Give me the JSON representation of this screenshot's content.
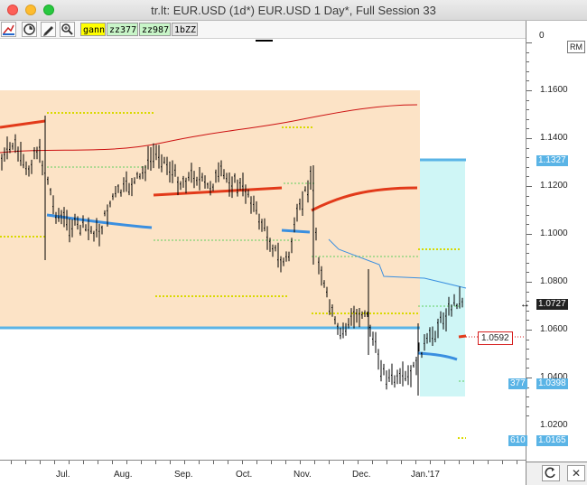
{
  "window": {
    "title": "tr.lt: EUR.USD (1d*) EUR.USD 1 Day*, Full Session 33"
  },
  "toolbar": {
    "buttons": [
      "chart-type-icon",
      "timer-icon",
      "pencil-icon",
      "zoom-icon"
    ],
    "chips": [
      {
        "label": "gann",
        "color": "#ffff00"
      },
      {
        "label": "zz377",
        "color": "#c8f5c8"
      },
      {
        "label": "zz987",
        "color": "#c8f5c8"
      },
      {
        "label": "1bZZ",
        "color": "#e6e6e6"
      }
    ]
  },
  "axis": {
    "top_label": "0",
    "rm_label": "RM",
    "price_labels": [
      "1.1600",
      "1.1400",
      "1.1200",
      "1.1000",
      "1.0800",
      "1.0600",
      "1.0400",
      "1.0200"
    ],
    "month_labels": [
      "Jul.",
      "Aug.",
      "Sep.",
      "Oct.",
      "Nov.",
      "Dec.",
      "Jan.'17"
    ]
  },
  "tags": {
    "high_level": {
      "value": "1.1327",
      "color": "#5ab4e6"
    },
    "last_price": {
      "value": "1.0727",
      "color": "#222222"
    },
    "box_price": {
      "value": "1.0592",
      "color": "#d62020"
    },
    "zz377": {
      "label": "377",
      "value": "1.0398",
      "color": "#5ab4e6"
    },
    "zz610": {
      "label": "610",
      "value": "1.0165",
      "color": "#5ab4e6"
    }
  },
  "colors": {
    "orange_zone": "#fce3c6",
    "cyan_zone": "#cff6f6",
    "level_line": "#5ab4e6",
    "red_ma": "#cc1111",
    "thick_red": "#e23a1a",
    "blue_ma": "#3a8fe0",
    "yellow_dash": "#d9d900",
    "green_dash": "#5fcf5f",
    "bars": "#000000"
  }
}
